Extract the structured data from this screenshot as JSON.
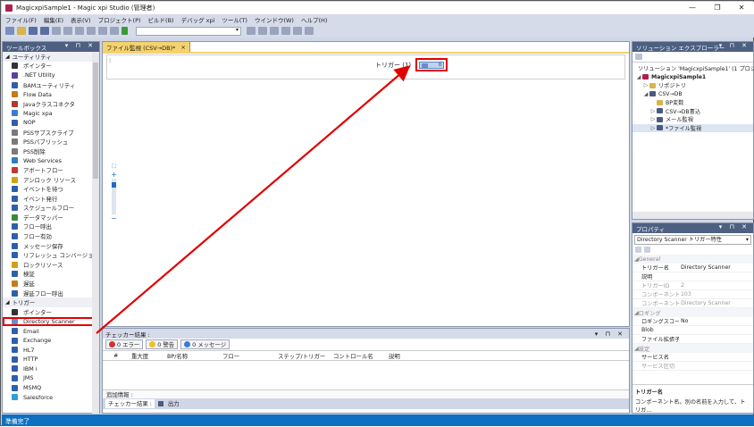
{
  "window": {
    "title": "MagicxpiSample1 - Magic xpi Studio (管理者)",
    "controls": [
      "—",
      "❐",
      "✕"
    ]
  },
  "menu": [
    "ファイル(F)",
    "編集(E)",
    "表示(V)",
    "プロジェクト(P)",
    "ビルド(B)",
    "デバッグ xpi",
    "ツール(T)",
    "ウインドウ(W)",
    "ヘルプ(H)"
  ],
  "toolbox": {
    "title": "ツールボックス",
    "categories": [
      {
        "label": "ユーティリティ"
      },
      {
        "label": "トリガー"
      }
    ],
    "utility_items": [
      {
        "label": "ポインター",
        "icon": "pointer-icon",
        "color": "#333333"
      },
      {
        "label": ".NET Utility",
        "icon": "dotnet-icon",
        "color": "#5a3fa0"
      },
      {
        "label": "BAMユーティリティ",
        "icon": "bam-icon",
        "color": "#2f5fa8"
      },
      {
        "label": "Flow Data",
        "icon": "flow-data-icon",
        "color": "#c77a1a"
      },
      {
        "label": "Javaクラスコネクタ",
        "icon": "java-icon",
        "color": "#b03a2e"
      },
      {
        "label": "Magic xpa",
        "icon": "magic-icon",
        "color": "#3a7bd5"
      },
      {
        "label": "NOP",
        "icon": "nop-icon",
        "color": "#2f5fa8"
      },
      {
        "label": "PSSサブスクライブ",
        "icon": "pss-subscribe-icon",
        "color": "#7a7a7a"
      },
      {
        "label": "PSSパブリッシュ",
        "icon": "pss-publish-icon",
        "color": "#7a7a7a"
      },
      {
        "label": "PSS削除",
        "icon": "pss-delete-icon",
        "color": "#7a7a7a"
      },
      {
        "label": "Web Services",
        "icon": "web-services-icon",
        "color": "#2f7fbf"
      },
      {
        "label": "アボートフロー",
        "icon": "abort-flow-icon",
        "color": "#c0392b"
      },
      {
        "label": "アンロック リソース",
        "icon": "unlock-icon",
        "color": "#d4a017"
      },
      {
        "label": "イベントを待つ",
        "icon": "wait-event-icon",
        "color": "#2f5fa8"
      },
      {
        "label": "イベント発行",
        "icon": "raise-event-icon",
        "color": "#2f5fa8"
      },
      {
        "label": "スケジュールフロー",
        "icon": "schedule-flow-icon",
        "color": "#2f5fa8"
      },
      {
        "label": "データマッパー",
        "icon": "data-mapper-icon",
        "color": "#3a8a3a"
      },
      {
        "label": "フロー呼出",
        "icon": "invoke-flow-icon",
        "color": "#2f5fa8"
      },
      {
        "label": "フロー有効",
        "icon": "enable-flow-icon",
        "color": "#2f5fa8"
      },
      {
        "label": "メッセージ保存",
        "icon": "save-message-icon",
        "color": "#2f5fa8"
      },
      {
        "label": "リフレッシュ コンバージョン",
        "icon": "refresh-icon",
        "color": "#2f5fa8"
      },
      {
        "label": "ロックリソース",
        "icon": "lock-icon",
        "color": "#d4a017"
      },
      {
        "label": "検証",
        "icon": "validate-icon",
        "color": "#2f5fa8"
      },
      {
        "label": "遅延",
        "icon": "delay-icon",
        "color": "#c77a1a"
      },
      {
        "label": "遅延フロー呼出",
        "icon": "delayed-invoke-icon",
        "color": "#2f5fa8"
      }
    ],
    "trigger_items": [
      {
        "label": "ポインター",
        "icon": "pointer-icon",
        "color": "#333333"
      },
      {
        "label": "Directory Scanner",
        "icon": "directory-scanner-icon",
        "color": "#6a8cc8",
        "selected": true
      },
      {
        "label": "Email",
        "icon": "email-icon",
        "color": "#2f5fa8"
      },
      {
        "label": "Exchange",
        "icon": "exchange-icon",
        "color": "#2f5fa8"
      },
      {
        "label": "HL7",
        "icon": "hl7-icon",
        "color": "#2f5fa8"
      },
      {
        "label": "HTTP",
        "icon": "http-icon",
        "color": "#2f5fa8"
      },
      {
        "label": "IBM i",
        "icon": "ibm-icon",
        "color": "#2f5fa8"
      },
      {
        "label": "JMS",
        "icon": "jms-icon",
        "color": "#2f5fa8"
      },
      {
        "label": "MSMQ",
        "icon": "msmq-icon",
        "color": "#2f5fa8"
      },
      {
        "label": "Salesforce",
        "icon": "salesforce-icon",
        "color": "#2f9fd8"
      }
    ]
  },
  "editor": {
    "tab_label": "ファイル監視 (CSV→DB)*",
    "tab_close": "×",
    "trigger_label": "トリガー (1)",
    "trigger_badge": "0",
    "zoom_plus": "+",
    "zoom_minus": "−"
  },
  "checker": {
    "title": "チェッカー結果 :",
    "buttons": [
      {
        "label": "0 エラー",
        "color": "#d0342c"
      },
      {
        "label": "0 警告",
        "color": "#f0c020"
      },
      {
        "label": "0 メッセージ",
        "color": "#3a7bd5"
      }
    ],
    "columns": [
      "#",
      "重大度",
      "BP/名称",
      "フロー",
      "ステップ/トリガー",
      "コントロール名",
      "説明"
    ],
    "details": "追加情報 :",
    "tabs": [
      "チェッカー結果 :",
      "出力"
    ]
  },
  "solution": {
    "title": "ソリューション エクスプローラー",
    "nodes": [
      {
        "label": "ソリューション 'MagicxpiSample1' (1 プロジェ",
        "depth": 0,
        "twisty": "",
        "icon": "solution-icon"
      },
      {
        "label": "MagicxpiSample1",
        "depth": 0,
        "twisty": "◢",
        "icon": "project-icon",
        "bold": true
      },
      {
        "label": "リポジトリ",
        "depth": 1,
        "twisty": "▷",
        "icon": "repository-icon"
      },
      {
        "label": "CSV→DB",
        "depth": 1,
        "twisty": "◢",
        "icon": "bp-icon"
      },
      {
        "label": "BP変数",
        "depth": 2,
        "twisty": "",
        "icon": "bp-vars-icon"
      },
      {
        "label": "CSV→DB書込",
        "depth": 2,
        "twisty": "▷",
        "icon": "flow-icon"
      },
      {
        "label": "メール監視",
        "depth": 2,
        "twisty": "▷",
        "icon": "flow-icon"
      },
      {
        "label": "*ファイル監視",
        "depth": 2,
        "twisty": "▷",
        "icon": "flow-icon",
        "selected": true
      }
    ]
  },
  "properties": {
    "title": "プロパティ",
    "selector": "Directory Scanner トリガー特性",
    "categories": [
      {
        "label": "General",
        "rows": [
          {
            "k": "トリガー名",
            "v": "Directory Scanner",
            "dim": false
          },
          {
            "k": "説明",
            "v": "",
            "dim": false
          },
          {
            "k": "トリガーID",
            "v": "2",
            "dim": true
          },
          {
            "k": "コンポーネントID",
            "v": "103",
            "dim": true
          },
          {
            "k": "コンポーネントタイプ",
            "v": "Directory Scanner",
            "dim": true
          }
        ]
      },
      {
        "label": "ロギング",
        "rows": [
          {
            "k": "ロギングスコープ",
            "v": "No",
            "dim": false
          },
          {
            "k": "Blob",
            "v": "",
            "dim": false
          },
          {
            "k": "ファイル拡張子",
            "v": "",
            "dim": false
          }
        ]
      },
      {
        "label": "設定",
        "rows": [
          {
            "k": "サービス名",
            "v": "",
            "dim": false
          },
          {
            "k": "サービス区切",
            "v": "",
            "dim": true
          }
        ]
      }
    ],
    "desc_title": "トリガー名",
    "desc_text": "コンポーネント名。別の名前を入力して、トリガ..."
  },
  "status": "準備完了"
}
